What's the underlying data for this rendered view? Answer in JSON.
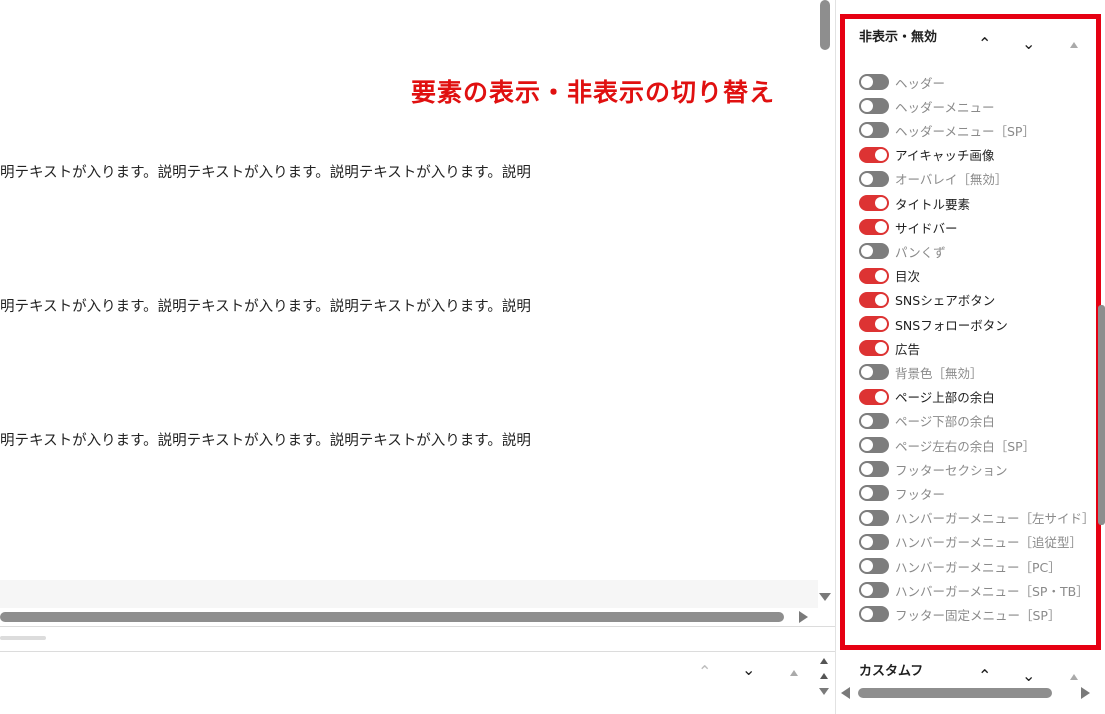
{
  "editor": {
    "annotation": "要素の表示・非表示の切り替え",
    "paragraphs": [
      "明テキストが入ります。説明テキストが入ります。説明テキストが入ります。説明",
      "明テキストが入ります。説明テキストが入ります。説明テキストが入ります。説明",
      "明テキストが入ります。説明テキストが入ります。説明テキストが入ります。説明"
    ],
    "controls": {
      "up_glyph": "⌃",
      "down_glyph": "⌄"
    }
  },
  "sidebar": {
    "panel_title": "非表示・無効",
    "move_up_glyph": "⌃",
    "move_down_glyph": "⌄",
    "items": [
      {
        "label": "ヘッダー",
        "on": false
      },
      {
        "label": "ヘッダーメニュー",
        "on": false
      },
      {
        "label": "ヘッダーメニュー［SP］",
        "on": false
      },
      {
        "label": "アイキャッチ画像",
        "on": true
      },
      {
        "label": "オーバレイ［無効］",
        "on": false
      },
      {
        "label": "タイトル要素",
        "on": true
      },
      {
        "label": "サイドバー",
        "on": true
      },
      {
        "label": "パンくず",
        "on": false
      },
      {
        "label": "目次",
        "on": true
      },
      {
        "label": "SNSシェアボタン",
        "on": true
      },
      {
        "label": "SNSフォローボタン",
        "on": true
      },
      {
        "label": "広告",
        "on": true
      },
      {
        "label": "背景色［無効］",
        "on": false
      },
      {
        "label": "ページ上部の余白",
        "on": true
      },
      {
        "label": "ページ下部の余白",
        "on": false
      },
      {
        "label": "ページ左右の余白［SP］",
        "on": false
      },
      {
        "label": "フッターセクション",
        "on": false
      },
      {
        "label": "フッター",
        "on": false
      },
      {
        "label": "ハンバーガーメニュー［左サイド］",
        "on": false
      },
      {
        "label": "ハンバーガーメニュー［追従型］",
        "on": false
      },
      {
        "label": "ハンバーガーメニュー［PC］",
        "on": false
      },
      {
        "label": "ハンバーガーメニュー［SP・TB］",
        "on": false
      },
      {
        "label": "フッター固定メニュー［SP］",
        "on": false
      }
    ],
    "next_panel_title": "カスタムフ"
  },
  "colors": {
    "highlight_border": "#e60012",
    "toggle_on": "#dd3333",
    "toggle_off": "#7d7d7d",
    "annotation": "#e01010"
  }
}
